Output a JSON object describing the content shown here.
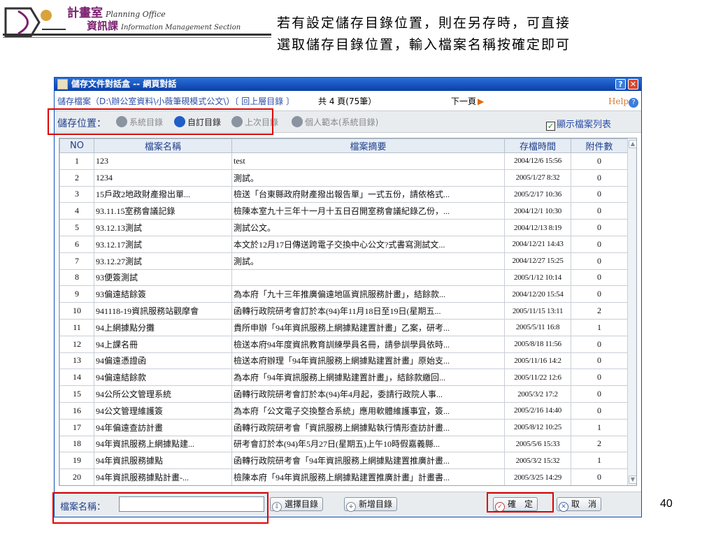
{
  "slide": {
    "logo_line1": "計畫室",
    "logo_line1_en": "Planning Office",
    "logo_line2": "資訊課",
    "logo_line2_en": "Information Management Section",
    "caption_line1": "若有設定儲存目錄位置，則在另存時，可直接",
    "caption_line2": "選取儲存目錄位置，輸入檔案名稱按確定即可",
    "page_number": "40"
  },
  "dialog": {
    "title": "儲存文件對話盒 -- 網頁對話",
    "help_button": "?",
    "close_button": "✕",
    "path_text": "儲存檔案（D:\\辦公室資料\\小薇筆硯模式公文\\）〔 回上層目錄 〕",
    "page_info": "共 4 頁(75筆）",
    "next_page": "下一頁",
    "help_link": "Help",
    "toolbar": {
      "label": "儲存位置：",
      "items": [
        {
          "label": "系統目錄",
          "active": false
        },
        {
          "label": "自訂目錄",
          "active": true
        },
        {
          "label": "上次目錄",
          "active": false
        },
        {
          "label": "個人範本(系統目錄)",
          "active": false
        }
      ],
      "show_list_label": "顯示檔案列表",
      "show_list_checked": true
    },
    "table": {
      "columns": [
        "NO",
        "檔案名稱",
        "檔案摘要",
        "存檔時間",
        "附件數"
      ],
      "rows": [
        [
          "1",
          "123",
          "test",
          "2004/12/6 15:56",
          "0"
        ],
        [
          "2",
          "1234",
          "測試。",
          "2005/1/27 8:32",
          "0"
        ],
        [
          "3",
          "15戶政2地政財產撥出單...",
          "檢送「台東縣政府財產撥出報告單」一式五份，請依格式...",
          "2005/2/17 10:36",
          "0"
        ],
        [
          "4",
          "93.11.15室務會議記錄",
          "檢陳本室九十三年十一月十五日召開室務會議紀錄乙份，...",
          "2004/12/1 10:30",
          "0"
        ],
        [
          "5",
          "93.12.13測試",
          "測試公文。",
          "2004/12/13 8:19",
          "0"
        ],
        [
          "6",
          "93.12.17測試",
          "本文於12月17日傳送跨電子交換中心公文?式書寫測試文...",
          "2004/12/21 14:43",
          "0"
        ],
        [
          "7",
          "93.12.27測試",
          "測試。",
          "2004/12/27 15:25",
          "0"
        ],
        [
          "8",
          "93便簽測試",
          "",
          "2005/1/12 10:14",
          "0"
        ],
        [
          "9",
          "93偏遠結餘簽",
          "為本府「九十三年推廣偏遠地區資訊服務計畫」，結餘款...",
          "2004/12/20 15:54",
          "0"
        ],
        [
          "10",
          "941118-19資訊服務站觀摩會",
          "函轉行政院研考會訂於本(94)年11月18日至19日(星期五...",
          "2005/11/15 13:11",
          "2"
        ],
        [
          "11",
          "94上網據點分攤",
          "貴所申辦「94年資訊服務上網據點建置計畫」乙案，研考...",
          "2005/5/11 16:8",
          "1"
        ],
        [
          "12",
          "94上課名冊",
          "檢送本府94年度資訊教育訓練學員名冊，請參訓學員依時...",
          "2005/8/18 11:56",
          "0"
        ],
        [
          "13",
          "94偏遠憑證函",
          "檢送本府辦理「94年資訊服務上網據點建置計畫」原始支...",
          "2005/11/16 14:2",
          "0"
        ],
        [
          "14",
          "94偏遠結餘款",
          "為本府「94年資訊服務上網據點建置計畫」，結餘款繳回...",
          "2005/11/22 12:6",
          "0"
        ],
        [
          "15",
          "94公所公文管理系統",
          "函轉行政院研考會訂於本(94)年4月起，委請行政院人事...",
          "2005/3/2 17:2",
          "0"
        ],
        [
          "16",
          "94公文管理維護簽",
          "為本府「公文電子交換整合系統」應用軟體維護事宜，簽...",
          "2005/2/16 14:40",
          "0"
        ],
        [
          "17",
          "94年偏遠查訪計畫",
          "函轉行政院研考會「資訊服務上網據點執行情形查訪計畫...",
          "2005/8/12 10:25",
          "1"
        ],
        [
          "18",
          "94年資訊服務上網據點建...",
          "研考會訂於本(94)年5月27日(星期五)上午10時假嘉義縣...",
          "2005/5/6 15:33",
          "2"
        ],
        [
          "19",
          "94年資訊服務據點",
          "函轉行政院研考會「94年資訊服務上網據點建置推廣計畫...",
          "2005/3/2 15:32",
          "1"
        ],
        [
          "20",
          "94年資訊服務據點計畫-...",
          "檢陳本府「94年資訊服務上網據點建置推廣計畫」計畫書...",
          "2005/3/25 14:29",
          "0"
        ]
      ]
    },
    "bottom": {
      "filename_label": "檔案名稱：",
      "filename_value": "",
      "select_dir_button": "選擇目錄",
      "new_dir_button": "新增目錄",
      "ok_button": "確　定",
      "cancel_button": "取　消"
    }
  },
  "colors": {
    "highlight": "#e00000",
    "titlebar": "#0a3fa8",
    "accent_text": "#1f3f8c",
    "logo": "#7a1f6e"
  }
}
